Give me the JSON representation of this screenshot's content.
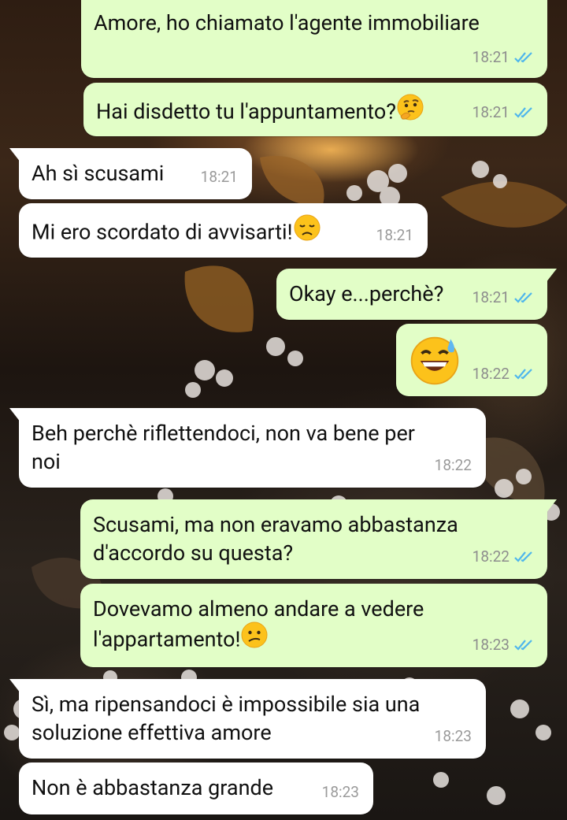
{
  "messages": [
    {
      "direction": "out",
      "text": "Amore, ho chiamato l'agente immobiliare",
      "time": "18:21",
      "status": "read"
    },
    {
      "direction": "out",
      "text": "Hai disdetto tu l'appuntamento?",
      "emoji": "thinking-face",
      "time": "18:21",
      "status": "read"
    },
    {
      "direction": "in",
      "text": "Ah sì scusami",
      "time": "18:21"
    },
    {
      "direction": "in",
      "text": "Mi ero scordato di avvisarti!",
      "emoji": "disappointed-face",
      "time": "18:21"
    },
    {
      "direction": "out",
      "text": "Okay e...perchè?",
      "time": "18:21",
      "status": "read"
    },
    {
      "direction": "out",
      "text": "",
      "emoji": "grinning-face-with-sweat",
      "time": "18:22",
      "status": "read"
    },
    {
      "direction": "in",
      "line1": "Beh perchè riflettendoci, non va bene per",
      "line2": "noi",
      "time": "18:22"
    },
    {
      "direction": "out",
      "line1": "Scusami, ma non eravamo abbastanza",
      "line2": "d'accordo su questa?",
      "time": "18:22",
      "status": "read"
    },
    {
      "direction": "out",
      "line1": "Dovevamo almeno andare a vedere",
      "line2": "l'appartamento!",
      "emoji": "confused-face",
      "time": "18:23",
      "status": "read"
    },
    {
      "direction": "in",
      "line1": "Sì, ma ripensandoci è impossibile sia una",
      "line2": "soluzione effettiva amore",
      "time": "18:23"
    },
    {
      "direction": "in",
      "text": "Non è abbastanza grande",
      "time": "18:23"
    }
  ],
  "colors": {
    "outgoing_bubble": "#e2fec7",
    "incoming_bubble": "#ffffff",
    "read_ticks": "#4fb6ec",
    "timestamp": "#8d8d8d"
  }
}
